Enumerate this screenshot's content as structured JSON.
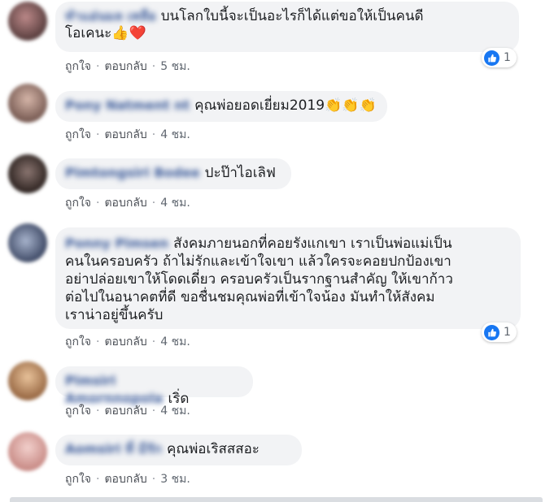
{
  "comments": [
    {
      "name": "ทำแอ่นมล เหลือ",
      "text_line1": "บนโลกใบนี้จะเป็นอะไรก็ได้แต่ขอให้เป็นคนดี",
      "text_line2": "โอเคนะ",
      "emoji": "👍❤️",
      "like_label": "ถูกใจ",
      "reply_label": "ตอบกลับ",
      "time": "5 ชม.",
      "reaction_count": "1",
      "avatar_color": "#8a6b6b"
    },
    {
      "name": "Pony Natment nt",
      "text_line1": "คุณพ่อยอดเยี่ยม2019",
      "emoji": "👏👏👏",
      "like_label": "ถูกใจ",
      "reply_label": "ตอบกลับ",
      "time": "4 ชม.",
      "avatar_color": "#b79a8f"
    },
    {
      "name": "Pimtongsiri Bodee",
      "text_line1": "ปะป๊าไอเลิฟ",
      "like_label": "ถูกใจ",
      "reply_label": "ตอบกลับ",
      "time": "4 ชม.",
      "avatar_color": "#5a4a45"
    },
    {
      "name": "Ponny Pimsen",
      "text_line1": "สังคมภายนอกที่คอยรังแกเขา เราเป็นพ่อแม่เป็น",
      "text_line2": "คนในครอบครัว ถ้าไม่รักและเข้าใจเขา แล้วใครจะคอยปกป้องเขา",
      "text_line3": "อย่าปล่อยเขาให้โดดเดี่ยว ครอบครัวเป็นรากฐานสำคัญ ให้เขาก้าว",
      "text_line4": "ต่อไปในอนาคตที่ดี ขอชื่นชมคุณพ่อที่เข้าใจน้อง มันทำให้สังคม",
      "text_line5": "เราน่าอยู่ขึ้นครับ",
      "like_label": "ถูกใจ",
      "reply_label": "ตอบกลับ",
      "time": "4 ชม.",
      "reaction_count": "1",
      "avatar_color": "#6e7fa0"
    },
    {
      "name": "Pimsiri Amornnopola",
      "text_line1": "เริ่ด",
      "like_label": "ถูกใจ",
      "reply_label": "ตอบกลับ",
      "time": "4 ชม.",
      "avatar_color": "#c8906a"
    },
    {
      "name": "Aomsiri ที่ มีรัก",
      "text_line1": "คุณพ่อเริสสสอะ",
      "like_label": "ถูกใจ",
      "reply_label": "ตอบกลับ",
      "time": "3 ชม.",
      "avatar_color": "#d9a7a0"
    }
  ],
  "colors": {
    "name_link": "#385898",
    "bubble_bg": "#f2f3f5",
    "like_blue": "#1877f2",
    "meta_gray": "#606770"
  }
}
